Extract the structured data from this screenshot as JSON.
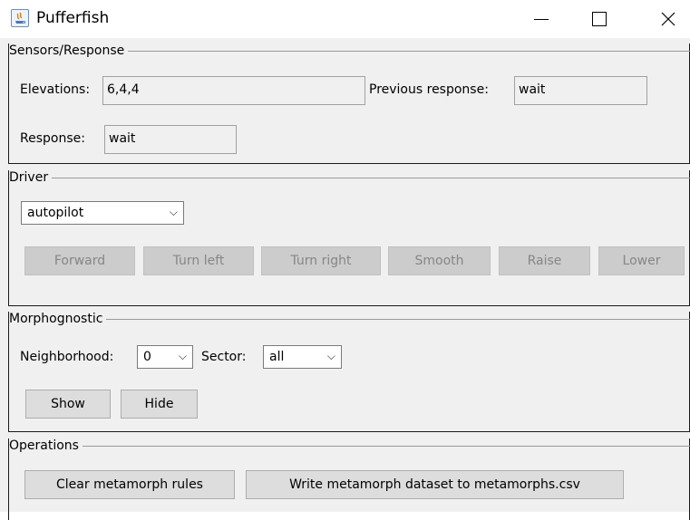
{
  "window": {
    "title": "Pufferfish",
    "controls": {
      "minimize_icon": "minimize-icon",
      "maximize_icon": "maximize-icon",
      "close_icon": "close-icon",
      "close_glyph": "✕"
    }
  },
  "sensors": {
    "section_title": "Sensors/Response",
    "elevations_label": "Elevations:",
    "elevations_value": "6,4,4",
    "previous_response_label": "Previous response:",
    "previous_response_value": "wait",
    "response_label": "Response:",
    "response_value": "wait"
  },
  "driver": {
    "section_title": "Driver",
    "mode_selected": "autopilot",
    "buttons": [
      "Forward",
      "Turn left",
      "Turn right",
      "Smooth",
      "Raise",
      "Lower"
    ]
  },
  "morphognostic": {
    "section_title": "Morphognostic",
    "neighborhood_label": "Neighborhood:",
    "neighborhood_value": "0",
    "sector_label": "Sector:",
    "sector_value": "all",
    "show_label": "Show",
    "hide_label": "Hide"
  },
  "operations": {
    "section_title": "Operations",
    "clear_label": "Clear metamorph rules",
    "write_label": "Write metamorph dataset to metamorphs.csv"
  },
  "glyphs": {
    "chevron": "⌵"
  }
}
